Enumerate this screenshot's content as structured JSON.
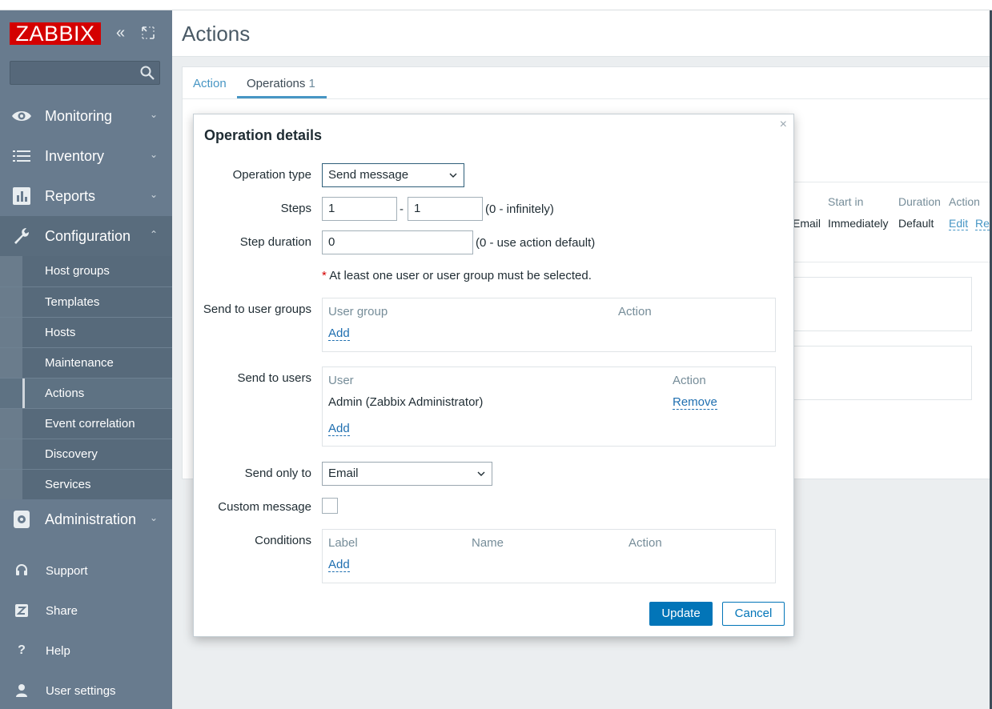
{
  "sidebar": {
    "logo": "ZABBIX",
    "collapse_glyph": "«",
    "menu": [
      {
        "label": "Monitoring",
        "icon": "eye-icon"
      },
      {
        "label": "Inventory",
        "icon": "list-icon"
      },
      {
        "label": "Reports",
        "icon": "bar-chart-icon"
      },
      {
        "label": "Configuration",
        "icon": "wrench-icon"
      }
    ],
    "configuration_submenu": [
      "Host groups",
      "Templates",
      "Hosts",
      "Maintenance",
      "Actions",
      "Event correlation",
      "Discovery",
      "Services"
    ],
    "administration": "Administration",
    "bottom": [
      {
        "label": "Support",
        "icon": "headset-icon"
      },
      {
        "label": "Share",
        "icon": "share-icon"
      },
      {
        "label": "Help",
        "icon": "help-icon"
      },
      {
        "label": "User settings",
        "icon": "user-icon"
      }
    ]
  },
  "page": {
    "title": "Actions",
    "tabs": {
      "action": "Action",
      "operations": "Operations",
      "operations_count": "1"
    }
  },
  "background_table": {
    "headers": {
      "start_in": "Start in",
      "duration": "Duration",
      "action": "Action"
    },
    "row": {
      "details": "Email",
      "start_in": "Immediately",
      "duration": "Default",
      "edit": "Edit",
      "remove": "Re"
    }
  },
  "dialog": {
    "title": "Operation details",
    "close": "×",
    "operation_type": {
      "label": "Operation type",
      "value": "Send message"
    },
    "steps": {
      "label": "Steps",
      "from": "1",
      "sep": "-",
      "to": "1",
      "hint": "(0 - infinitely)"
    },
    "step_duration": {
      "label": "Step duration",
      "value": "0",
      "hint": "(0 - use action default)"
    },
    "warning": {
      "star": "*",
      "text": "At least one user or user group must be selected."
    },
    "send_to_user_groups": {
      "label": "Send to user groups",
      "col_group": "User group",
      "col_action": "Action",
      "add": "Add"
    },
    "send_to_users": {
      "label": "Send to users",
      "col_user": "User",
      "col_action": "Action",
      "user": "Admin (Zabbix Administrator)",
      "remove": "Remove",
      "add": "Add"
    },
    "send_only_to": {
      "label": "Send only to",
      "value": "Email"
    },
    "custom_message": {
      "label": "Custom message"
    },
    "conditions": {
      "label": "Conditions",
      "col_label": "Label",
      "col_name": "Name",
      "col_action": "Action",
      "add": "Add"
    },
    "buttons": {
      "update": "Update",
      "cancel": "Cancel"
    }
  }
}
